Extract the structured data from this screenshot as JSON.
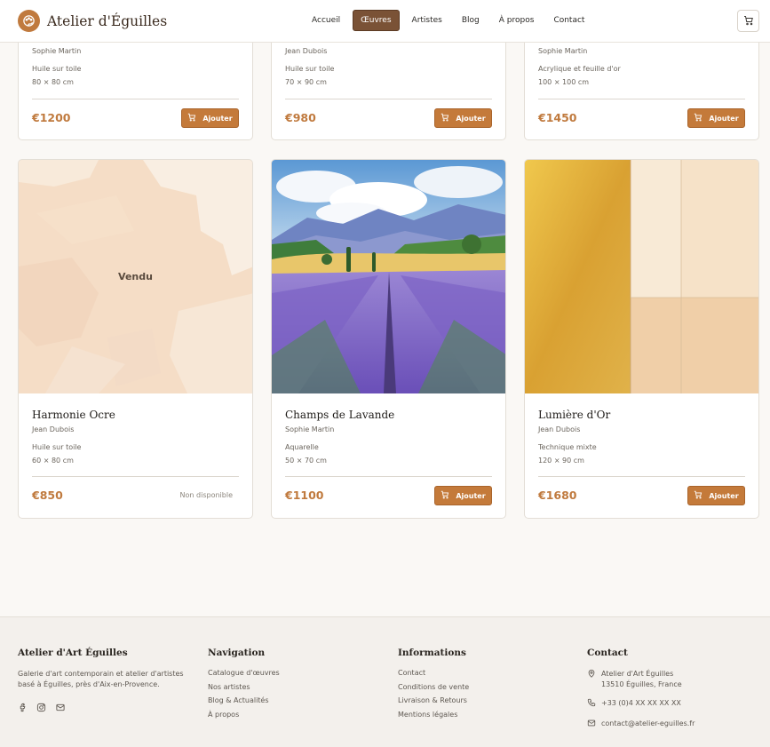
{
  "header": {
    "brand": "Atelier d'Éguilles",
    "nav": [
      "Accueil",
      "Œuvres",
      "Artistes",
      "Blog",
      "À propos",
      "Contact"
    ]
  },
  "top_cards": [
    {
      "artist": "Sophie Martin",
      "medium": "Huile sur toile",
      "size": "80 × 80 cm",
      "price": "€1200",
      "button": "Ajouter"
    },
    {
      "artist": "Jean Dubois",
      "medium": "Huile sur toile",
      "size": "70 × 90 cm",
      "price": "€980",
      "button": "Ajouter"
    },
    {
      "artist": "Sophie Martin",
      "medium": "Acrylique et feuille d'or",
      "size": "100 × 100 cm",
      "price": "€1450",
      "button": "Ajouter"
    }
  ],
  "cards": [
    {
      "title": "Harmonie Ocre",
      "artist": "Jean Dubois",
      "medium": "Huile sur toile",
      "size": "60 × 80 cm",
      "price": "€850",
      "sold_label": "Vendu",
      "status": "Non disponible"
    },
    {
      "title": "Champs de Lavande",
      "artist": "Sophie Martin",
      "medium": "Aquarelle",
      "size": "50 × 70 cm",
      "price": "€1100",
      "button": "Ajouter"
    },
    {
      "title": "Lumière d'Or",
      "artist": "Jean Dubois",
      "medium": "Technique mixte",
      "size": "120 × 90 cm",
      "price": "€1680",
      "button": "Ajouter"
    }
  ],
  "footer": {
    "about": {
      "title": "Atelier d'Art Éguilles",
      "text_1": "Galerie d'art contemporain et atelier d'artistes",
      "text_2": "basé à Éguilles, près d'Aix-en-Provence."
    },
    "navigation": {
      "title": "Navigation",
      "links": [
        "Catalogue d'œuvres",
        "Nos artistes",
        "Blog & Actualités",
        "À propos"
      ]
    },
    "informations": {
      "title": "Informations",
      "links": [
        "Contact",
        "Conditions de vente",
        "Livraison & Retours",
        "Mentions légales"
      ]
    },
    "contact": {
      "title": "Contact",
      "address_1": "Atelier d'Art Éguilles",
      "address_2": "13510 Éguilles, France",
      "phone": "+33 (0)4 XX XX XX XX",
      "email": "contact@atelier-eguilles.fr"
    }
  },
  "colors": {
    "accent": "#c07a3e",
    "nav_active": "#7a5236",
    "button": "#c47a3a"
  }
}
